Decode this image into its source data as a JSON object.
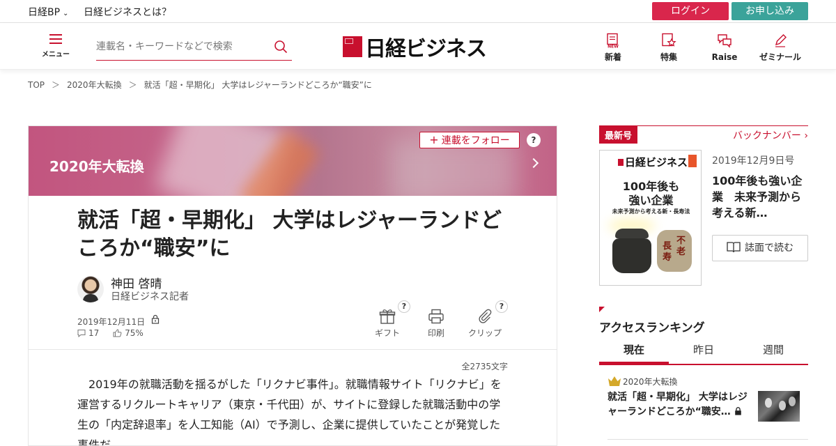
{
  "topbar": {
    "nikkei_bp": "日経BP",
    "about": "日経ビジネスとは？",
    "login": "ログイン",
    "apply": "お申し込み"
  },
  "header": {
    "menu_label": "メニュー",
    "search_placeholder": "連載名・キーワードなどで検索",
    "logo_text": "日経ビジネス",
    "nav": [
      {
        "label": "新着",
        "icon": "new-icon"
      },
      {
        "label": "特集",
        "icon": "feature-icon"
      },
      {
        "label": "Raise",
        "icon": "raise-icon"
      },
      {
        "label": "ゼミナール",
        "icon": "seminar-icon"
      }
    ]
  },
  "breadcrumb": {
    "items": [
      "TOP",
      "2020年大転換",
      "就活「超・早期化」 大学はレジャーランドどころか“職安”に"
    ],
    "separator": "＞"
  },
  "article": {
    "series_title": "2020年大転換",
    "follow_label": "連載をフォロー",
    "help": "?",
    "headline": "就活「超・早期化」 大学はレジャーランドどころか“職安”に",
    "author_name": "神田 啓晴",
    "author_role": "日経ビジネス記者",
    "date": "2019年12月11日",
    "comments": "17",
    "like_rate": "75%",
    "actions": [
      {
        "label": "ギフト",
        "icon": "gift-icon"
      },
      {
        "label": "印刷",
        "icon": "print-icon"
      },
      {
        "label": "クリップ",
        "icon": "clip-icon"
      }
    ],
    "word_count": "全2735文字",
    "body": "2019年の就職活動を揺るがした「リクナビ事件」。就職情報サイト「リクナビ」を運営するリクルートキャリア（東京・千代田）が、サイトに登録した就職活動中の学生の「内定辞退率」を人工知能（AI）で予測し、企業に提供していたことが発覚した事件だ。"
  },
  "sidebar": {
    "latest_issue_tag": "最新号",
    "back_numbers": "バックナンバー",
    "issue_date": "2019年12月9日号",
    "issue_title": "100年後も強い企業　未来予測から考える新…",
    "read_button": "誌面で読む",
    "cover": {
      "logo": "日経ビジネス",
      "headline_line1": "100年後も",
      "headline_line2": "強い企業",
      "tagline": "未来予測から考える新・長寿法",
      "jar_chars": [
        "不",
        "老",
        "長",
        "寿"
      ]
    },
    "ranking": {
      "title": "アクセスランキング",
      "tabs": [
        "現在",
        "昨日",
        "週間"
      ],
      "active_tab": 0,
      "items": [
        {
          "series": "2020年大転換",
          "headline": "就活「超・早期化」 大学はレジャーランドどころか“職安…"
        }
      ]
    }
  },
  "colors": {
    "brand_red": "#c8102e",
    "login_bg": "#d9264c",
    "apply_bg": "#3ba39a"
  }
}
